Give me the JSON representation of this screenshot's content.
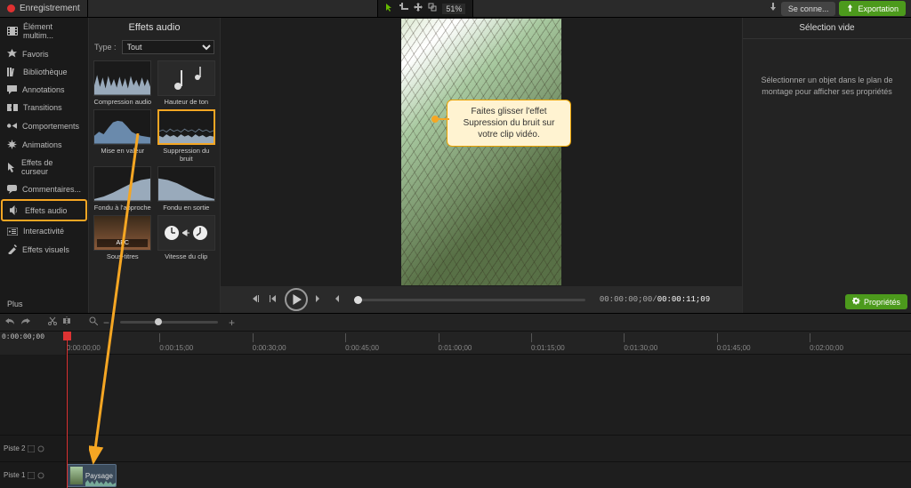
{
  "topbar": {
    "record_label": "Enregistrement",
    "zoom_value": "51%",
    "download_icon": "download",
    "signin_label": "Se conne...",
    "export_label": "Exportation"
  },
  "sidebar": {
    "items": [
      {
        "id": "media",
        "icon": "film",
        "label": "Élément multim..."
      },
      {
        "id": "favorites",
        "icon": "star",
        "label": "Favoris"
      },
      {
        "id": "library",
        "icon": "books",
        "label": "Bibliothèque"
      },
      {
        "id": "annotations",
        "icon": "speech",
        "label": "Annotations"
      },
      {
        "id": "transitions",
        "icon": "transition",
        "label": "Transitions"
      },
      {
        "id": "behaviors",
        "icon": "behaviors",
        "label": "Comportements"
      },
      {
        "id": "animations",
        "icon": "spark",
        "label": "Animations"
      },
      {
        "id": "cursor",
        "icon": "cursor",
        "label": "Effets de curseur"
      },
      {
        "id": "comments",
        "icon": "comment",
        "label": "Commentaires..."
      },
      {
        "id": "audio",
        "icon": "speaker",
        "label": "Effets audio",
        "selected": true
      },
      {
        "id": "interactivity",
        "icon": "quiz",
        "label": "Interactivité"
      },
      {
        "id": "visual",
        "icon": "wand",
        "label": "Effets visuels"
      }
    ],
    "more_label": "Plus"
  },
  "effects_panel": {
    "title": "Effets audio",
    "type_label": "Type :",
    "type_value": "Tout",
    "effects": [
      {
        "id": "compression",
        "label": "Compression audio"
      },
      {
        "id": "pitch",
        "label": "Hauteur de ton"
      },
      {
        "id": "highlight",
        "label": "Mise en valeur"
      },
      {
        "id": "noise",
        "label": "Suppression du bruit",
        "highlighted": true
      },
      {
        "id": "fadein",
        "label": "Fondu à l'approche"
      },
      {
        "id": "fadeout",
        "label": "Fondu en sortie"
      },
      {
        "id": "subtitles",
        "label": "Sous-titres"
      },
      {
        "id": "clipspeed",
        "label": "Vitesse du clip"
      }
    ]
  },
  "callout": {
    "text": "Faites glisser l'effet Supression du bruit sur votre clip vidéo."
  },
  "playback": {
    "timecode_current": "00:00:00;00",
    "timecode_total": "00:00:11;09"
  },
  "right_panel": {
    "title": "Sélection vide",
    "message": "Sélectionner un objet dans le plan de montage pour afficher ses propriétés",
    "props_btn_label": "Propriétés"
  },
  "timeline": {
    "current_tc": "0:00:00;00",
    "ruler_ticks": [
      "0:00:00;00",
      "0:00:15;00",
      "0:00:30;00",
      "0:00:45;00",
      "0:01:00;00",
      "0:01:15;00",
      "0:01:30;00",
      "0:01:45;00",
      "0:02:00;00"
    ],
    "tracks": [
      {
        "name": "Piste 2"
      },
      {
        "name": "Piste 1"
      }
    ],
    "clip_label": "Paysage"
  },
  "colors": {
    "accent_orange": "#f5a623",
    "accent_green": "#4c9a1c"
  }
}
